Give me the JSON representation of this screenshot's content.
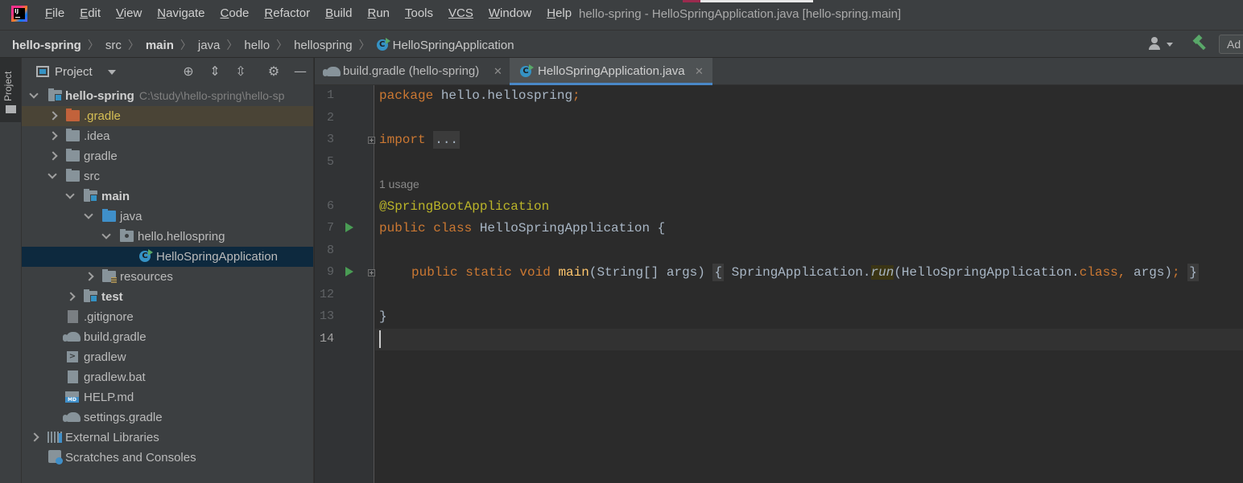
{
  "menubar": {
    "items": [
      {
        "mnemonic": "F",
        "rest": "ile"
      },
      {
        "mnemonic": "E",
        "rest": "dit"
      },
      {
        "mnemonic": "V",
        "rest": "iew"
      },
      {
        "mnemonic": "N",
        "rest": "avigate"
      },
      {
        "mnemonic": "C",
        "rest": "ode"
      },
      {
        "mnemonic": "R",
        "rest": "efactor"
      },
      {
        "mnemonic": "B",
        "rest": "uild"
      },
      {
        "mnemonic": "R",
        "rest": "un"
      },
      {
        "mnemonic": "T",
        "rest": "ools"
      },
      {
        "mnemonic": "VCS",
        "rest": ""
      },
      {
        "mnemonic": "W",
        "rest": "indow"
      },
      {
        "mnemonic": "H",
        "rest": "elp"
      }
    ],
    "window_title": "hello-spring - HelloSpringApplication.java [hello-spring.main]"
  },
  "navbar": {
    "breadcrumbs": [
      "hello-spring",
      "src",
      "main",
      "java",
      "hello",
      "hellospring",
      "HelloSpringApplication"
    ],
    "add_config_label": "Ad"
  },
  "tool_stripe": {
    "project_label": "Project"
  },
  "project_panel": {
    "title": "Project",
    "tree": {
      "root": "hello-spring",
      "root_path": "C:\\study\\hello-spring\\hello-sp",
      "gradle_dir": ".gradle",
      "idea": ".idea",
      "gradle": "gradle",
      "src": "src",
      "main": "main",
      "java": "java",
      "package": "hello.hellospring",
      "app_class": "HelloSpringApplication",
      "resources": "resources",
      "test": "test",
      "gitignore": ".gitignore",
      "build_gradle": "build.gradle",
      "gradlew": "gradlew",
      "gradlew_bat": "gradlew.bat",
      "help_md": "HELP.md",
      "settings_gradle": "settings.gradle",
      "external_libs": "External Libraries",
      "scratches": "Scratches and Consoles"
    }
  },
  "editor": {
    "tabs": [
      {
        "label": "build.gradle (hello-spring)",
        "active": false
      },
      {
        "label": "HelloSpringApplication.java",
        "active": true
      }
    ],
    "line_numbers": [
      "1",
      "2",
      "3",
      "5",
      "6",
      "7",
      "8",
      "9",
      "12",
      "13",
      "14"
    ],
    "usage_hint": "1 usage",
    "code": {
      "l1_kw": "package",
      "l1_rest": " hello.hellospring",
      "l1_semi": ";",
      "l3_kw": "import",
      "l3_fold": "...",
      "l6_ann": "@SpringBootApplication",
      "l7_kw": "public class",
      "l7_rest": " HelloSpringApplication {",
      "l9_kw": "public static void",
      "l9_fn": "main",
      "l9_args": "(String[] args) ",
      "l9_open": "{",
      "l9_call": " SpringApplication.",
      "l9_run": "run",
      "l9_call2": "(HelloSpringApplication.",
      "l9_class": "class",
      "l9_comma": ",",
      "l9_args2": " args)",
      "l9_semi": ";",
      "l9_close": "}",
      "l13": "}"
    }
  }
}
